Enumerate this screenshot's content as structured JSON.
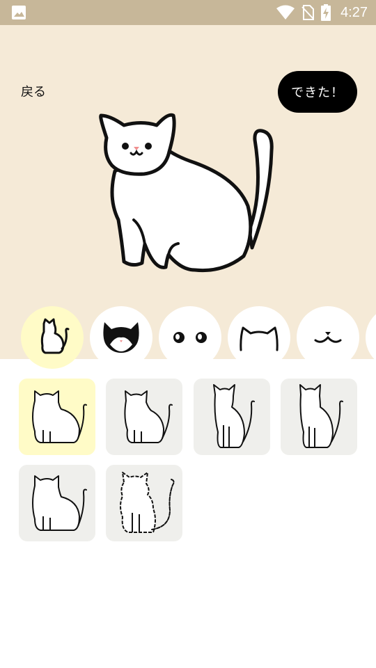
{
  "status_bar": {
    "time": "4:27",
    "icons": [
      "image-icon",
      "wifi-icon",
      "no-sim-icon",
      "battery-charging-icon"
    ]
  },
  "header": {
    "back_label": "戻る",
    "done_label": "できた！"
  },
  "colors": {
    "status_bar": "#c7b799",
    "editor_bg": "#f5ead7",
    "selected_bg": "#fffbc7",
    "tile_bg": "#efefec",
    "button_bg": "#000000"
  },
  "part_tabs": [
    {
      "icon": "cat-body-icon",
      "selected": true
    },
    {
      "icon": "cat-fur-pattern-icon",
      "selected": false
    },
    {
      "icon": "cat-eyes-icon",
      "selected": false
    },
    {
      "icon": "cat-ears-icon",
      "selected": false
    },
    {
      "icon": "cat-mouth-icon",
      "selected": false
    },
    {
      "icon": "more-parts-icon",
      "selected": false
    }
  ],
  "body_options": [
    {
      "icon": "chubby-sitting-cat-icon",
      "selected": true
    },
    {
      "icon": "sitting-cat-icon",
      "selected": false
    },
    {
      "icon": "slim-cat-icon",
      "selected": false
    },
    {
      "icon": "slim-cat-alt-icon",
      "selected": false
    },
    {
      "icon": "round-cat-icon",
      "selected": false
    },
    {
      "icon": "fluffy-cat-icon",
      "selected": false
    }
  ]
}
